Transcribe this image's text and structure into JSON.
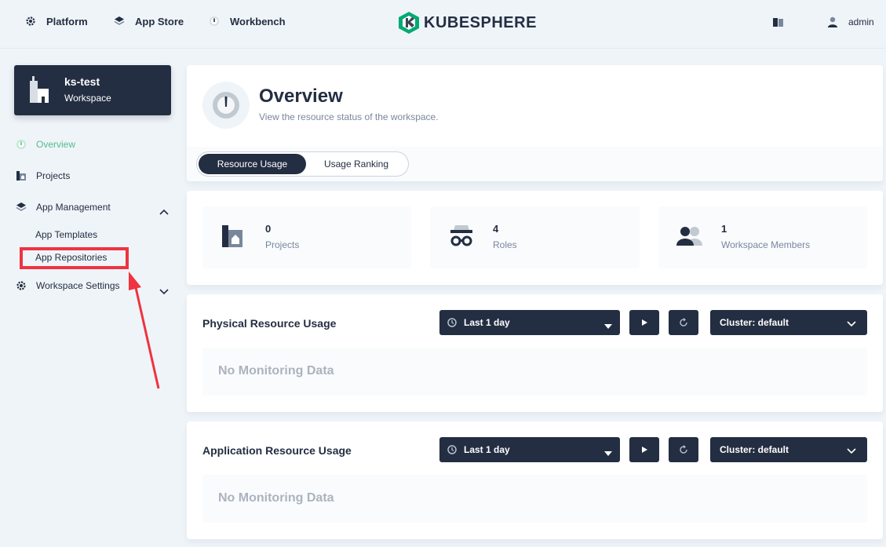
{
  "topnav": {
    "platform_label": "Platform",
    "appstore_label": "App Store",
    "workbench_label": "Workbench",
    "brand": "KUBESPHERE",
    "user_name": "admin"
  },
  "workspace": {
    "name": "ks-test",
    "type": "Workspace"
  },
  "sidebar": {
    "items": [
      {
        "label": "Overview",
        "icon": "dashboard-icon"
      },
      {
        "label": "Projects",
        "icon": "project-icon"
      },
      {
        "label": "App Management",
        "icon": "appcenter-icon"
      },
      {
        "label": "Workspace Settings",
        "icon": "gear-icon"
      }
    ],
    "app_management_children": [
      "App Templates",
      "App Repositories"
    ]
  },
  "overview": {
    "title": "Overview",
    "description": "View the resource status of the workspace.",
    "tabs": [
      "Resource Usage",
      "Usage Ranking"
    ]
  },
  "stats": [
    {
      "value": "0",
      "label": "Projects",
      "icon": "project-icon"
    },
    {
      "value": "4",
      "label": "Roles",
      "icon": "role-icon"
    },
    {
      "value": "1",
      "label": "Workspace Members",
      "icon": "members-icon"
    }
  ],
  "physical": {
    "title": "Physical Resource Usage",
    "time_range": "Last 1 day",
    "cluster": "Cluster: default",
    "empty_text": "No Monitoring Data"
  },
  "application": {
    "title": "Application Resource Usage",
    "time_range": "Last 1 day",
    "cluster": "Cluster: default",
    "empty_text": "No Monitoring Data"
  },
  "colors": {
    "dark": "#242e42",
    "accent_green": "#55bc8a",
    "highlight_red": "#ef3340",
    "background": "#eff4f9"
  }
}
